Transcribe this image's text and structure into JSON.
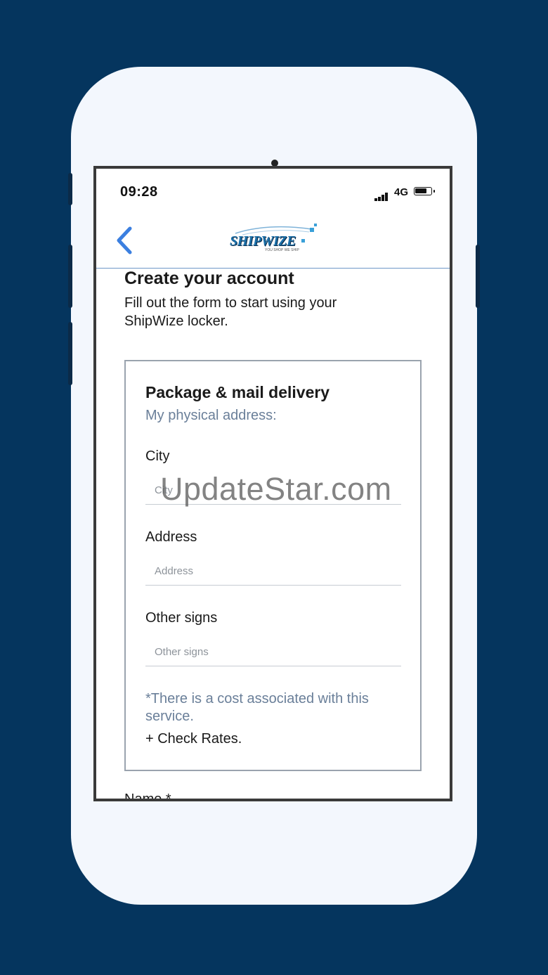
{
  "status_bar": {
    "time": "09:28",
    "network": "4G"
  },
  "header": {
    "logo_text": "SHIPWIZE",
    "logo_tagline": "YOU SHOP WE SHIP"
  },
  "page": {
    "title": "Create your account",
    "intro": "Fill out the form to start using your ShipWize locker."
  },
  "card": {
    "title": "Package & mail delivery",
    "subtitle": "My physical address:",
    "fields": [
      {
        "label": "City",
        "placeholder": "City",
        "value": ""
      },
      {
        "label": "Address",
        "placeholder": "Address",
        "value": ""
      },
      {
        "label": "Other signs",
        "placeholder": "Other signs",
        "value": ""
      }
    ],
    "note": "*There is a cost associated with this service.",
    "check_rates": "+ Check Rates."
  },
  "next_field_label": "Name *",
  "watermark": "UpdateStar.com",
  "colors": {
    "background": "#05355e",
    "accent": "#3b7fe0",
    "muted_text": "#6a7f99"
  }
}
